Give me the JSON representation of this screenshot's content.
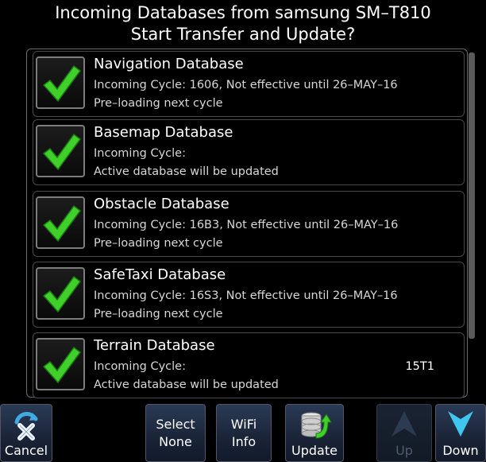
{
  "header": {
    "line1": "Incoming Databases from samsung SM–T810",
    "line2": "Start Transfer and Update?"
  },
  "databases": [
    {
      "title": "Navigation Database",
      "line1": "Incoming Cycle:  1606, Not effective until 26–MAY–16",
      "line1_right": "",
      "line2": "Pre–loading next cycle",
      "checked": true
    },
    {
      "title": "Basemap Database",
      "line1": "Incoming Cycle:",
      "line1_right": "",
      "line2": "Active database will be updated",
      "checked": true
    },
    {
      "title": "Obstacle Database",
      "line1": "Incoming Cycle:  16B3, Not effective until 26–MAY–16",
      "line1_right": "",
      "line2": "Pre–loading next cycle",
      "checked": true
    },
    {
      "title": "SafeTaxi Database",
      "line1": "Incoming Cycle:  16S3, Not effective until 26–MAY–16",
      "line1_right": "",
      "line2": "Pre–loading next cycle",
      "checked": true
    },
    {
      "title": "Terrain Database",
      "line1": "Incoming Cycle:",
      "line1_right": "15T1",
      "line2": "Active database will be updated",
      "checked": true
    }
  ],
  "softkeys": {
    "cancel": "Cancel",
    "select_none_1": "Select",
    "select_none_2": "None",
    "wifi_info_1": "WiFi",
    "wifi_info_2": "Info",
    "update": "Update",
    "up": "Up",
    "down": "Down"
  },
  "icons": {
    "check": "green-check-icon",
    "cancel": "cancel-x-icon",
    "update": "database-update-icon",
    "up": "up-arrow-icon",
    "down": "down-arrow-icon"
  },
  "colors": {
    "check_green": "#3fd12a",
    "arrow_cyan": "#3fc6f0"
  }
}
